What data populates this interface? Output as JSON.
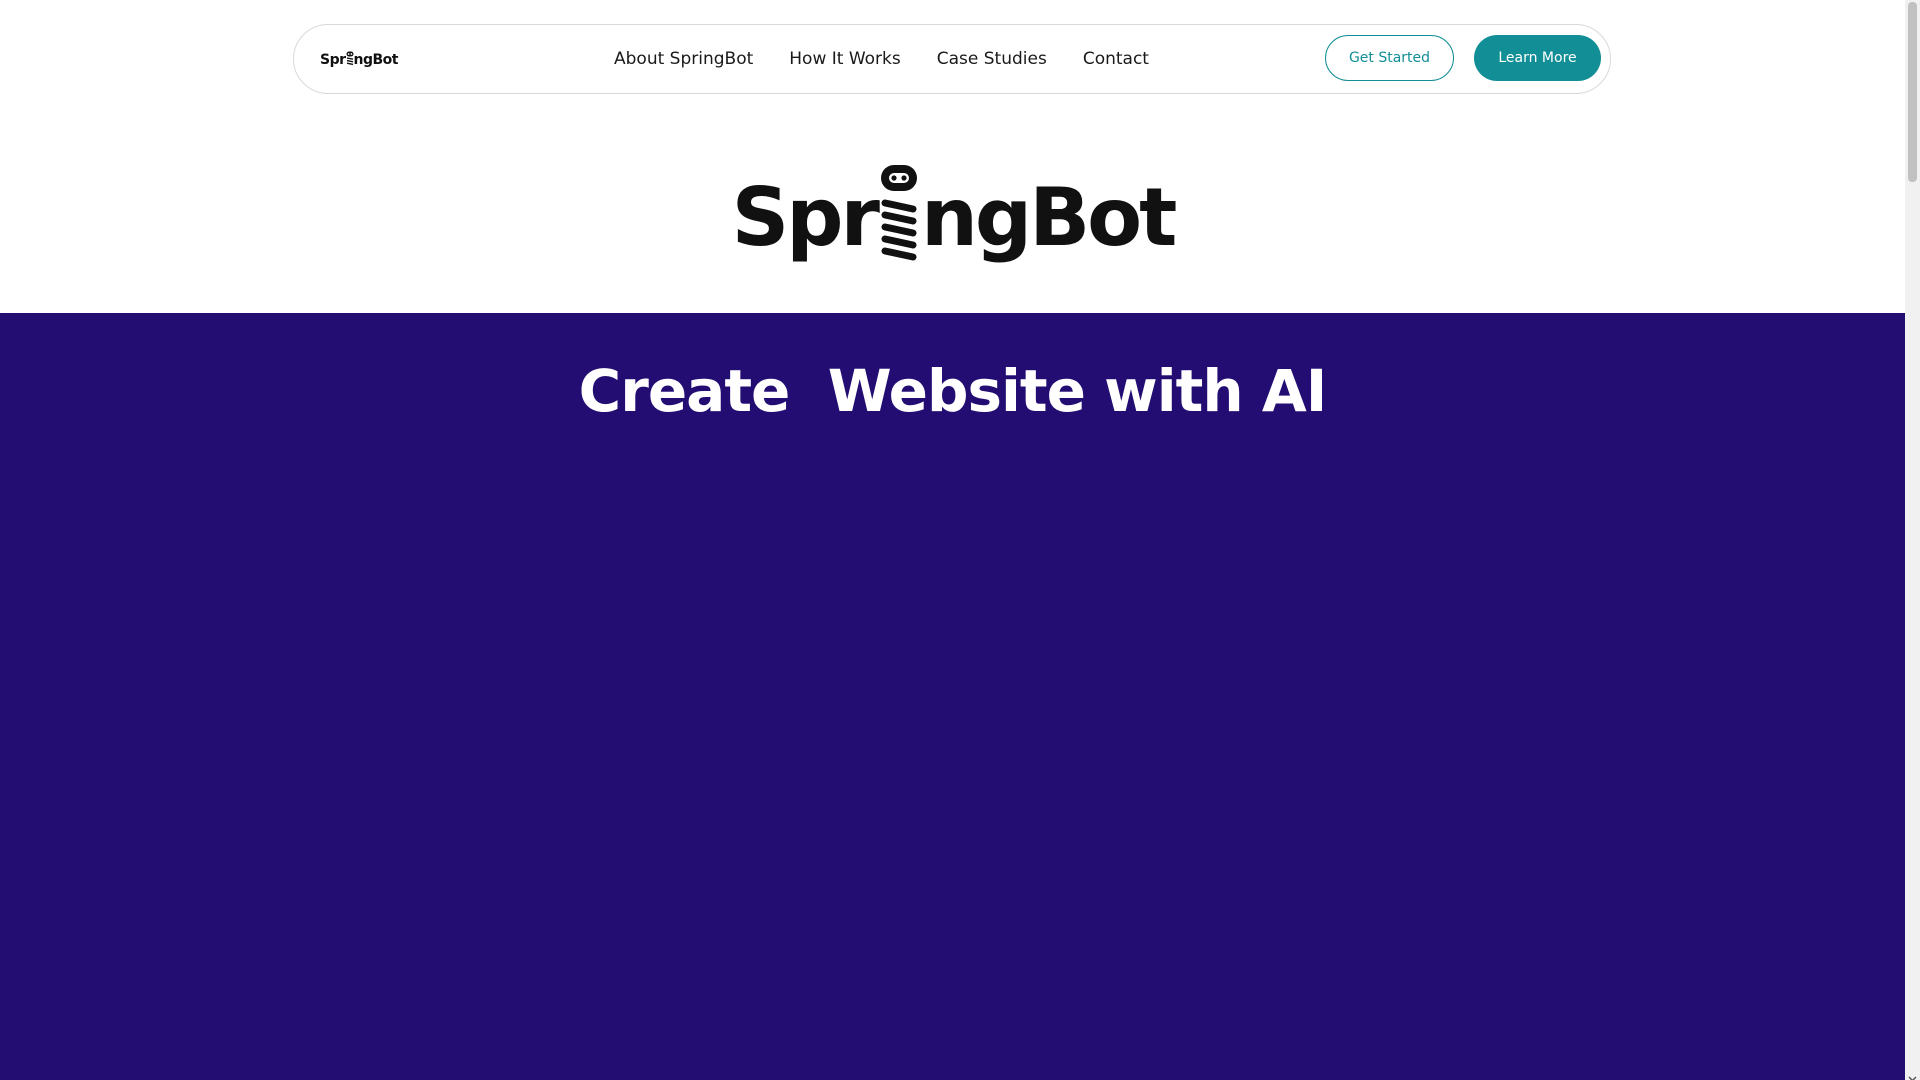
{
  "brand": {
    "name_prefix": "Spr",
    "name_suffix": "ngBot",
    "logo_icon": "robot-spring-icon"
  },
  "nav": {
    "links": [
      {
        "label": "About SpringBot"
      },
      {
        "label": "How It Works"
      },
      {
        "label": "Case Studies"
      },
      {
        "label": "Contact"
      }
    ],
    "get_started_label": "Get Started",
    "learn_more_label": "Learn More"
  },
  "hero": {
    "title": "Create  Website with AI"
  },
  "colors": {
    "accent_teal": "#128e96",
    "hero_bg": "#230d73",
    "text_dark": "#111111"
  },
  "scrollbar": {
    "icon": "chevron-down-icon"
  }
}
